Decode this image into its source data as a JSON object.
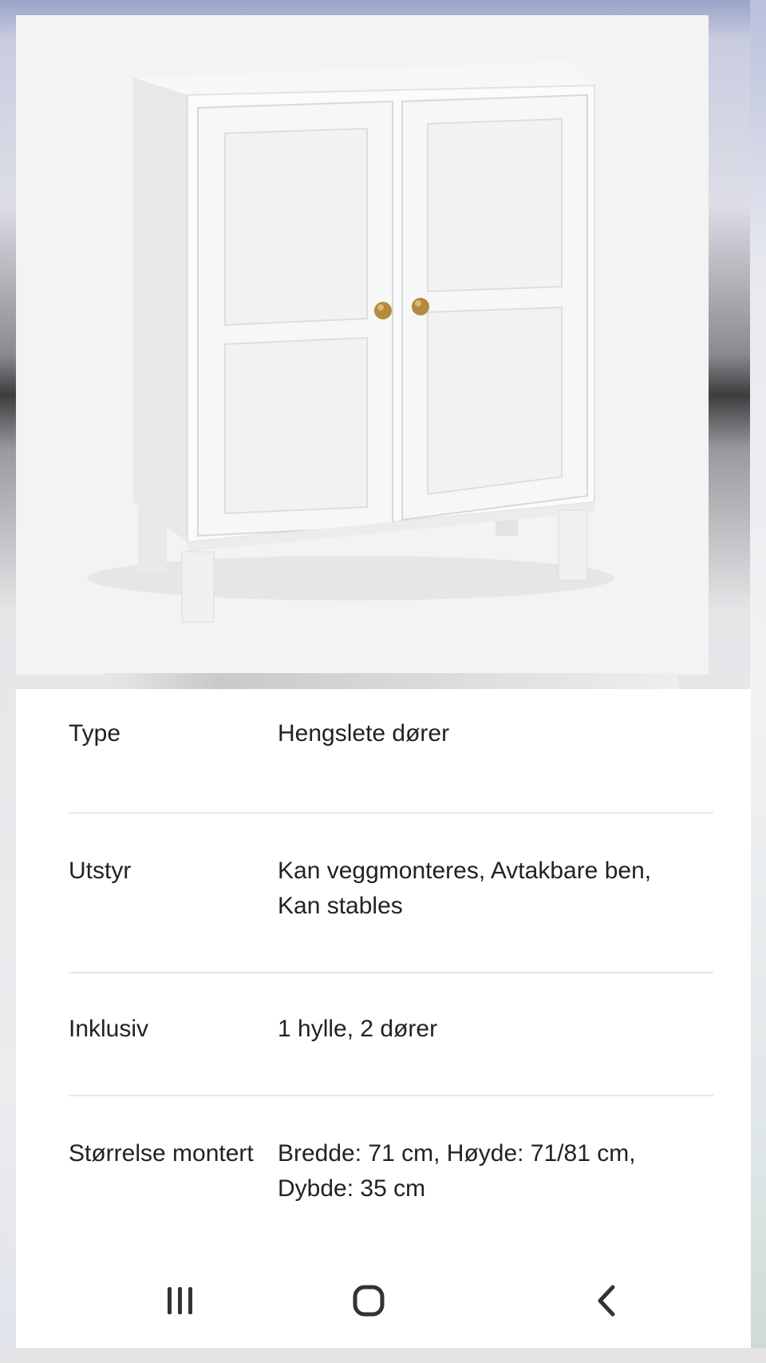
{
  "product_image": {
    "icon": "cabinet-illustration",
    "colors": {
      "body": "#fafafa",
      "handle": "#b48a3e",
      "background": "#f3f3f4"
    }
  },
  "specs": [
    {
      "label": "Type",
      "value": "Hengslete dører"
    },
    {
      "label": "Utstyr",
      "value_lines": [
        "Kan veggmonteres, Avtakbare ben,",
        "Kan stables"
      ]
    },
    {
      "label": "Inklusiv",
      "value": "1 hylle, 2 dører"
    },
    {
      "label": "Størrelse montert",
      "value_lines": [
        "Bredde: 71 cm, Høyde: 71/81 cm,",
        "Dybde: 35 cm"
      ]
    }
  ],
  "navbar": {
    "recents": "recent-apps-icon",
    "home": "home-icon",
    "back": "back-icon"
  }
}
